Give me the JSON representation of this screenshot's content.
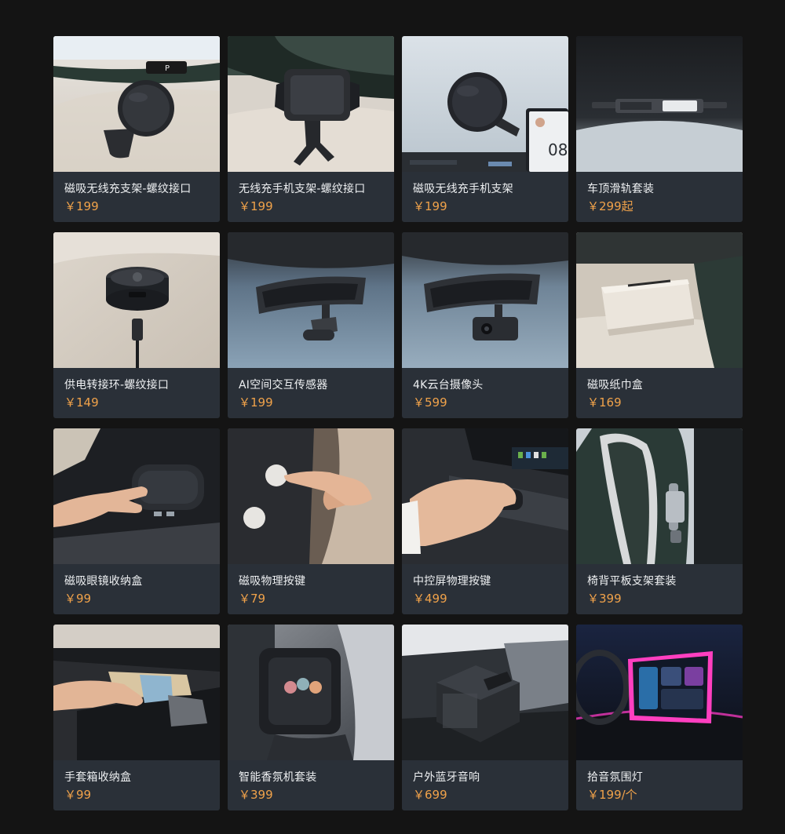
{
  "products": [
    {
      "name": "磁吸无线充支架-螺纹接口",
      "price": "￥199",
      "image_alt": "black magnetic wireless charging mount on dashboard",
      "photo_text": "P"
    },
    {
      "name": "无线充手机支架-螺纹接口",
      "price": "￥199",
      "image_alt": "wireless charging phone cradle with clamp arms"
    },
    {
      "name": "磁吸无线充手机支架",
      "price": "￥199",
      "image_alt": "magnetic wireless charging phone mount beside center screen",
      "photo_text": "08"
    },
    {
      "name": "车顶滑轨套装",
      "price": "￥299起",
      "image_alt": "roof rail accessory kit above windshield"
    },
    {
      "name": "供电转接环-螺纹接口",
      "price": "￥149",
      "image_alt": "power adapter ring with USB-C cable"
    },
    {
      "name": "AI空间交互传感器",
      "price": "￥199",
      "image_alt": "AI cabin sensor mounted under rearview mirror"
    },
    {
      "name": "4K云台摄像头",
      "price": "￥599",
      "image_alt": "4K gimbal camera under rearview mirror"
    },
    {
      "name": "磁吸纸巾盒",
      "price": "￥169",
      "image_alt": "white magnetic tissue box on seat"
    },
    {
      "name": "磁吸眼镜收纳盒",
      "price": "￥99",
      "image_alt": "hand opening magnetic glasses case"
    },
    {
      "name": "磁吸物理按键",
      "price": "￥79",
      "image_alt": "finger pressing magnetic physical button"
    },
    {
      "name": "中控屏物理按键",
      "price": "￥499",
      "image_alt": "hand turning knob below center screen"
    },
    {
      "name": "椅背平板支架套装",
      "price": "￥399",
      "image_alt": "tablet holder mounted on seat back"
    },
    {
      "name": "手套箱收纳盒",
      "price": "￥99",
      "image_alt": "glovebox organizer tray with items"
    },
    {
      "name": "智能香氛机套装",
      "price": "￥399",
      "image_alt": "smart fragrance diffuser in center console"
    },
    {
      "name": "户外蓝牙音响",
      "price": "￥699",
      "image_alt": "outdoor bluetooth speaker in cabin"
    },
    {
      "name": "拾音氛围灯",
      "price": "￥199/个",
      "image_alt": "pink ambient light strip around center display"
    }
  ],
  "colors": {
    "page_bg": "#141414",
    "card_bg": "#2a3038",
    "name_text": "#eef0f2",
    "price_text": "#f0a24a"
  }
}
